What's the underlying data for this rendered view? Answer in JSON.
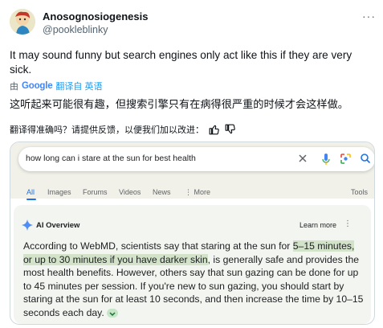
{
  "tweet": {
    "author_name": "Anosognosiogenesis",
    "author_handle": "@pookleblinky",
    "text": "It may sound funny but search engines only act like this if they are very sick.",
    "translated_by_prefix": "由",
    "translated_by_google": "Google",
    "translated_by_link": "翻译自 英语",
    "translation": "这听起来可能很有趣，但搜索引擎只有在病得很严重的时候才会这样做。",
    "rate_prompt": "翻译得准确吗？请提供反馈，以便我们加以改进："
  },
  "screenshot": {
    "query": "how long can i stare at the sun for best health",
    "tabs": [
      "All",
      "Images",
      "Forums",
      "Videos",
      "News",
      "More",
      "Tools"
    ],
    "ai_overview": {
      "title": "AI Overview",
      "learn_more": "Learn more",
      "body_part1": "According to WebMD, scientists say that staring at the sun for ",
      "highlight": "5–15 minutes, or up to 30 minutes if you have darker skin",
      "body_part2": ", is generally safe and provides the most health benefits. However, others say that sun gazing can be done for up to 45 minutes per session. If you're new to sun gazing, you should start by staring at the sun for at least 10 seconds, and then increase the time by 10–15 seconds each day."
    }
  },
  "colors": {
    "link_blue": "#1d9bf0",
    "google_blue": "#1a73e8",
    "highlight_green": "#d3e3c9",
    "ai_panel_bg": "#f3f6f0"
  },
  "icons": [
    "more-icon",
    "google-logo",
    "thumbs-up-icon",
    "thumbs-down-icon",
    "clear-icon",
    "mic-icon",
    "lens-icon",
    "search-icon",
    "sparkle-icon",
    "kebab-icon",
    "chevron-down-icon"
  ]
}
